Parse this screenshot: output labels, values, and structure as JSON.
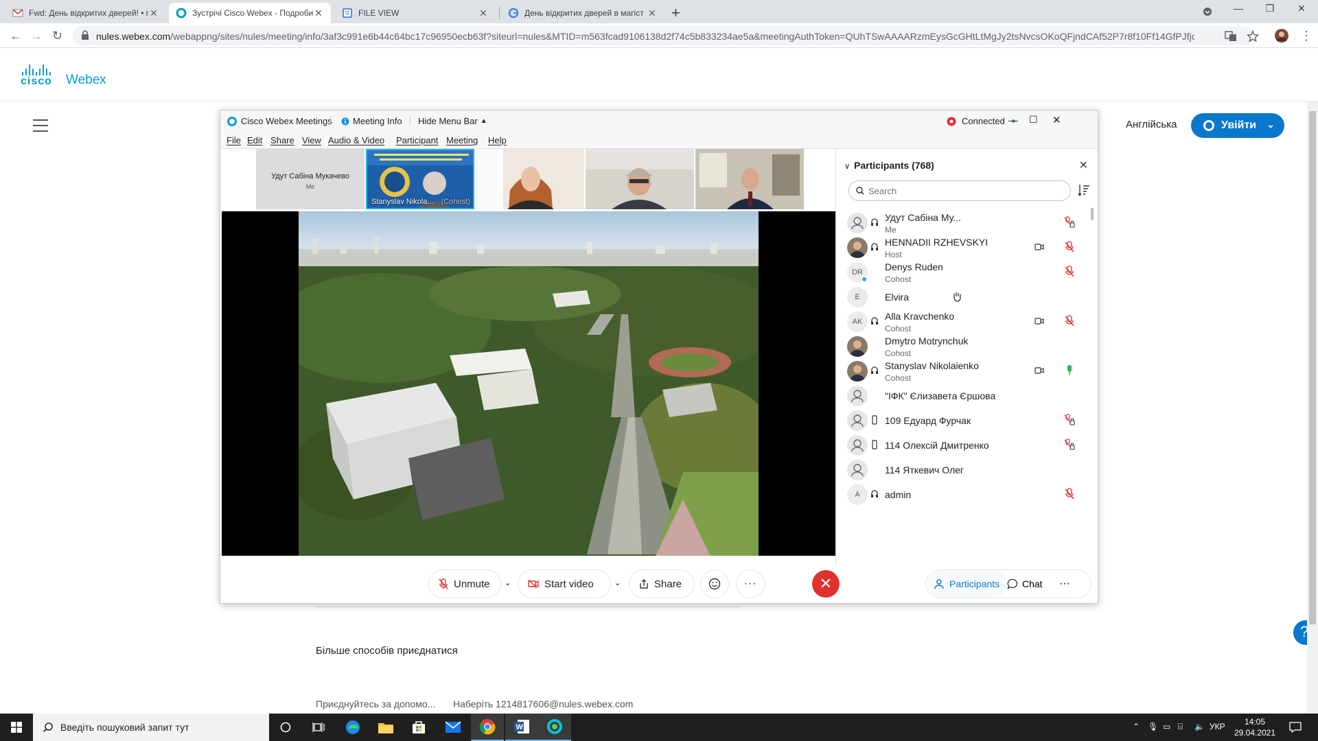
{
  "browser": {
    "tabs": [
      {
        "title": "Fwd: День відкритих дверей! • n",
        "active": false
      },
      {
        "title": "Зустрічі Cisco Webex - Подробиц",
        "active": true
      },
      {
        "title": "FILE VIEW",
        "active": false
      },
      {
        "title": "День відкритих дверей в магіст",
        "active": false
      }
    ],
    "new_tab": "+",
    "url_host": "nules.webex.com",
    "url_path": "/webappng/sites/nules/meeting/info/3af3c991e6b44c64bc17c96950ecb63f?siteurl=nules&MTID=m563fcad9106138d2f74c5b833234ae5a&meetingAuthToken=QUhTSwAAAARzmEysGcGHtLtMgJy2tsNvcsOKoQFjndCAf52P7r8f10Ff14GfPJfjc04tvdd..."
  },
  "page": {
    "brand_cisco": "cisco",
    "brand_webex": "Webex",
    "language": "Англійська",
    "login_label": "Увійти",
    "more_ways": "Більше способів приєднатися",
    "join_label": "Приєднуйтесь за допомо...",
    "join_value": "Наберіть 1214817606@nules.webex.com",
    "help": "?"
  },
  "meeting": {
    "app_title": "Cisco Webex Meetings",
    "info_label": "Meeting Info",
    "hide_menu": "Hide Menu Bar",
    "connected": "Connected",
    "menu": [
      "File",
      "Edit",
      "Share",
      "View",
      "Audio & Video",
      "Participant",
      "Meeting",
      "Help"
    ],
    "self_tile": {
      "name": "Удут Сабіна Мукачево",
      "role": "Me"
    },
    "active_tile": {
      "name": "Stanyslav Nikola...",
      "role": "(Cohost)"
    },
    "panel_title": "Participants (768)",
    "search_placeholder": "Search",
    "participants": [
      {
        "name": "Удут Сабіна Му...",
        "role": "Me",
        "avatar": "person",
        "mic": "muted-locked",
        "cam": false
      },
      {
        "name": "HENNADII RZHEVSKYI",
        "role": "Host",
        "avatar": "photo",
        "mic": "muted",
        "cam": true
      },
      {
        "name": "Denys Ruden",
        "role": "Cohost",
        "avatar": "DR",
        "mic": "muted",
        "cam": false
      },
      {
        "name": "Elvira",
        "role": "",
        "avatar": "E",
        "mic": "hand",
        "cam": false
      },
      {
        "name": "Alla Kravchenko",
        "role": "Cohost",
        "avatar": "AK",
        "mic": "muted",
        "cam": true
      },
      {
        "name": "Dmytro Motrynchuk",
        "role": "Cohost",
        "avatar": "photo",
        "mic": "",
        "cam": false
      },
      {
        "name": "Stanyslav Nikolaienko",
        "role": "Cohost",
        "avatar": "photo",
        "mic": "active",
        "cam": true
      },
      {
        "name": "\"ІФК\" Єлизавета Єршова",
        "role": "",
        "avatar": "person",
        "mic": "",
        "cam": false
      },
      {
        "name": "109 Едуард Фурчак",
        "role": "",
        "avatar": "person",
        "mic": "muted-locked",
        "cam": false
      },
      {
        "name": "114 Олексій Дмитренко",
        "role": "",
        "avatar": "person",
        "mic": "muted-locked",
        "cam": false
      },
      {
        "name": "114 Яткевич Олег",
        "role": "",
        "avatar": "person",
        "mic": "",
        "cam": false
      },
      {
        "name": "admin",
        "role": "",
        "avatar": "A",
        "mic": "muted",
        "cam": false
      }
    ],
    "controls": {
      "unmute": "Unmute",
      "start_video": "Start video",
      "share": "Share",
      "participants_tab": "Participants",
      "chat_tab": "Chat"
    }
  },
  "taskbar": {
    "search_placeholder": "Введіть пошуковий запит тут",
    "lang": "УКР",
    "time": "14:05",
    "date": "29.04.2021"
  }
}
